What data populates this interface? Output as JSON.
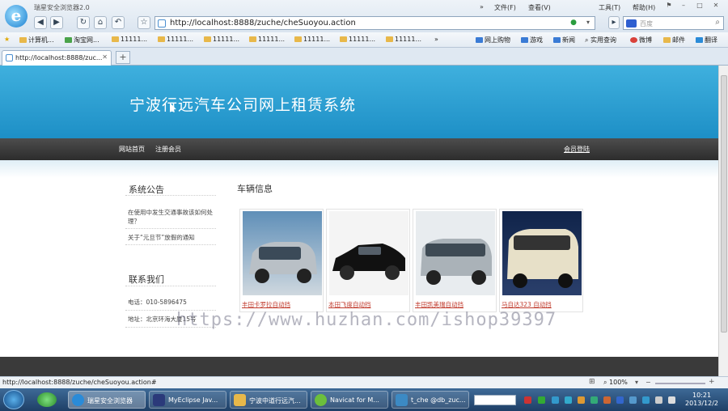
{
  "browser": {
    "app_name": "瑞星安全浏览器2.0",
    "menus": [
      "文件(F)",
      "查看(V)",
      "工具(T)",
      "帮助(H)"
    ],
    "url": "http://localhost:8888/zuche/cheSuoyou.action",
    "search_placeholder": "百度",
    "favorites": [
      "计算机...",
      "淘宝网...",
      "11111...",
      "11111...",
      "11111...",
      "11111...",
      "11111...",
      "11111...",
      "11111...",
      "网上购物",
      "游戏",
      "新闻",
      "实用查询",
      "微博",
      "邮件",
      "翻译"
    ],
    "tab_title": "http://localhost:8888/zuc...",
    "status_url": "http://localhost:8888/zuche/cheSuoyou.action#",
    "zoom": "100%"
  },
  "site": {
    "title": "宁波行远汽车公司网上租赁系统",
    "nav": [
      "网站首页",
      "注册会员"
    ],
    "login": "会员登陆",
    "notice_heading": "系统公告",
    "notices": [
      "在使用中发生交通事故该如何处理？",
      "关于“元旦节”放假的通知"
    ],
    "contact_heading": "联系我们",
    "phone": "电话：010-5896475",
    "address": "地址：北京环海大厦15号",
    "vehicles_heading": "车辆信息",
    "cars": [
      {
        "name": "丰田卡罗拉自动挡",
        "color": "silver"
      },
      {
        "name": "本田飞度自动挡",
        "color": "black"
      },
      {
        "name": "丰田凯美瑞自动挡",
        "color": "silver"
      },
      {
        "name": "马自达323 自动挡",
        "color": "cream"
      }
    ],
    "watermark": "https://www.huzhan.com/ishop39397"
  },
  "taskbar": {
    "items": [
      "瑞星安全浏览器",
      "MyEclipse Jav...",
      "宁波中道行远汽...",
      "Navicat for M...",
      "t_che @db_zuc..."
    ],
    "time": "10:21",
    "date": "2013/12/2"
  }
}
